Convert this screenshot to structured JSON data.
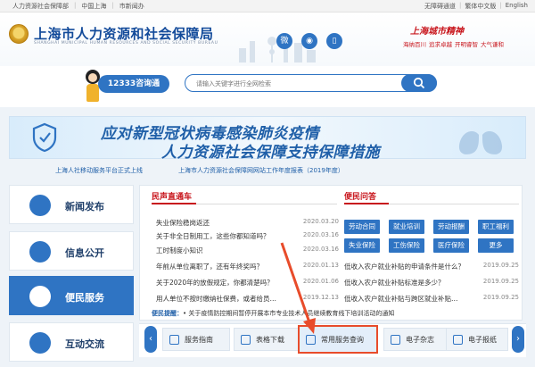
{
  "topbar": {
    "left": [
      "人力资源社会保障部",
      "中国上海",
      "市新闻办"
    ],
    "right": [
      "无障碍通道",
      "繁体中文版",
      "English"
    ]
  },
  "header": {
    "title": "上海市人力资源和社会保障局",
    "subtitle": "SHANGHAI MUNICIPAL HUMAN RESOURCES AND SOCIAL SECURITY BUREAU",
    "slogan_title": "上海城市精神",
    "slogans": [
      "海纳百川",
      "追求卓越",
      "开明睿智",
      "大气谦和"
    ]
  },
  "search": {
    "hotline": "12333咨询通",
    "placeholder": "请输入关键字进行全网检索"
  },
  "banner": {
    "line1": "应对新型冠状病毒感染肺炎疫情",
    "line2": "人力资源社会保障支持保障措施"
  },
  "notices": [
    "上海人社移动服务平台正式上线",
    "上海市人力资源社会保障网网站工作年度报表（2019年度）"
  ],
  "nav": [
    {
      "label": "新闻发布",
      "icon": "news-icon"
    },
    {
      "label": "信息公开",
      "icon": "info-icon"
    },
    {
      "label": "便民服务",
      "icon": "people-icon",
      "active": true
    },
    {
      "label": "互动交流",
      "icon": "chat-icon"
    }
  ],
  "sections": {
    "left_title": "民声直通车",
    "right_title": "便民问答"
  },
  "news": [
    {
      "title": "失业保险稳岗返还",
      "date": "2020.03.20"
    },
    {
      "title": "关于非全日制用工，这些你都知道吗？",
      "date": "2020.03.16"
    },
    {
      "title": "工时制度小知识",
      "date": "2020.03.16"
    },
    {
      "title": "年前从单位离职了，还有年终奖吗？",
      "date": "2020.01.13"
    },
    {
      "title": "关于2020年的放假规定，你都清楚吗？",
      "date": "2020.01.06"
    },
    {
      "title": "用人单位不按时缴纳社保费，或者给员…",
      "date": "2019.12.13"
    }
  ],
  "chips": [
    [
      "劳动合同",
      "就业培训",
      "劳动报酬",
      "职工福利"
    ],
    [
      "失业保险",
      "工伤保险",
      "医疗保险",
      "更多"
    ]
  ],
  "qa": [
    {
      "title": "低收入农户就业补贴的申请条件是什么？",
      "date": "2019.09.25"
    },
    {
      "title": "低收入农户就业补贴标准是多少？",
      "date": "2019.09.25"
    },
    {
      "title": "低收入农户就业补贴与跨区就业补贴…",
      "date": "2019.09.25"
    }
  ],
  "quick": {
    "label": "便民提醒：",
    "text": "• 关于疫情防控期间暂停开展本市专业技术人员继续教育线下培训活动的通知"
  },
  "services": [
    {
      "label": "服务指南"
    },
    {
      "label": "表格下载"
    },
    {
      "label": "常用服务查询",
      "highlight": true
    },
    {
      "label": "电子杂志"
    },
    {
      "label": "电子报纸"
    }
  ],
  "colors": {
    "primary": "#2f74c3",
    "accent_red": "#c8161d",
    "annotation": "#e84c2b"
  }
}
